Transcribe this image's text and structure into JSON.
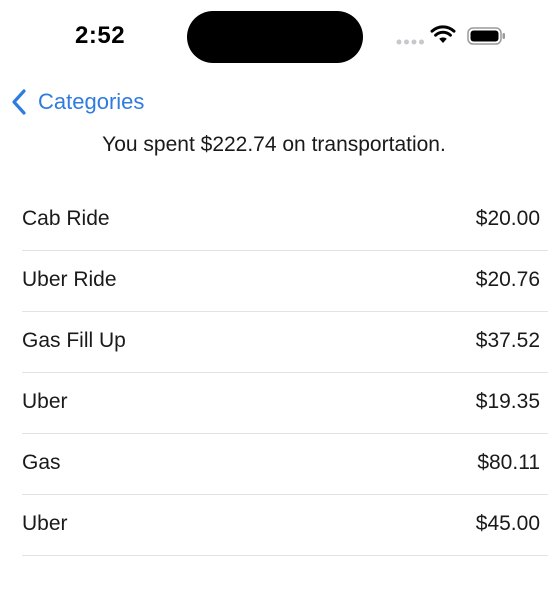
{
  "status_bar": {
    "time": "2:52",
    "icons": [
      "signal-dots-icon",
      "wifi-icon",
      "battery-icon"
    ]
  },
  "nav": {
    "back_label": "Categories",
    "back_icon": "chevron-left-icon",
    "accent_color": "#2f7ce0"
  },
  "summary": {
    "text": "You spent $222.74 on transportation."
  },
  "transactions": [
    {
      "name": "Cab Ride",
      "amount": "$20.00"
    },
    {
      "name": "Uber Ride",
      "amount": "$20.76"
    },
    {
      "name": "Gas Fill Up",
      "amount": "$37.52"
    },
    {
      "name": "Uber",
      "amount": "$19.35"
    },
    {
      "name": "Gas",
      "amount": "$80.11"
    },
    {
      "name": "Uber",
      "amount": "$45.00"
    }
  ]
}
